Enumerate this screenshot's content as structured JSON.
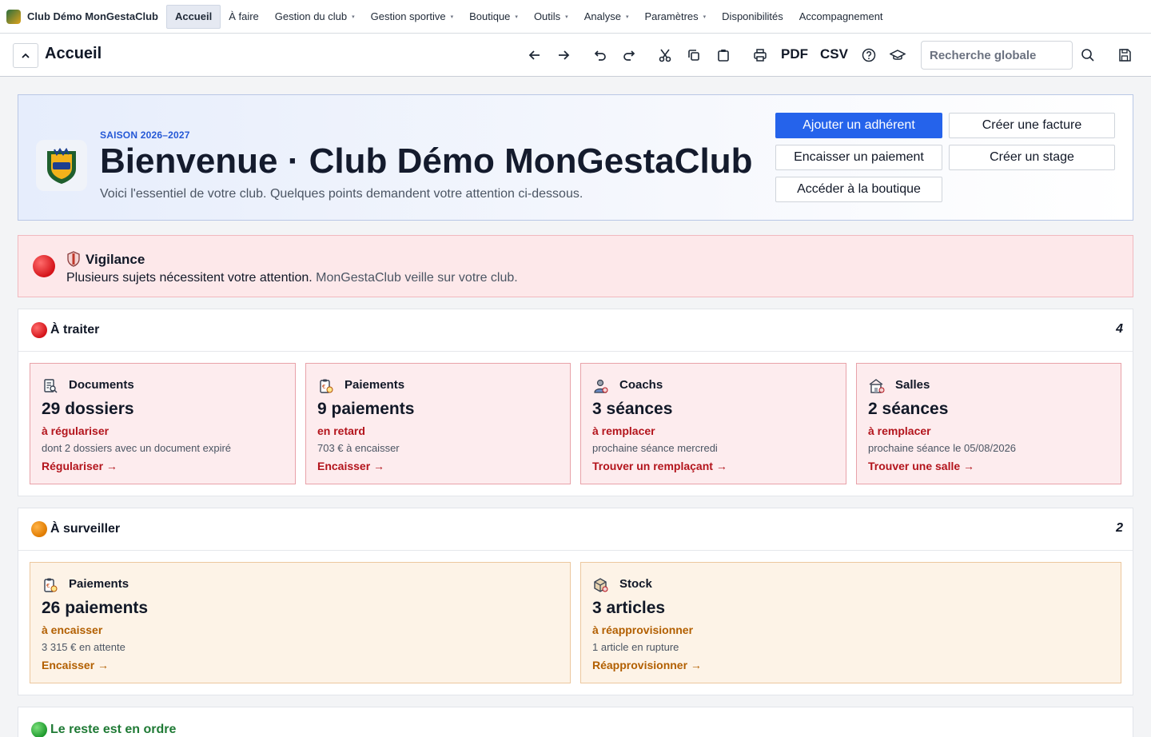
{
  "menubar": {
    "brand": "Club Démo MonGestaClub",
    "items": [
      {
        "label": "Accueil",
        "active": true,
        "dropdown": false
      },
      {
        "label": "À faire",
        "active": false,
        "dropdown": false
      },
      {
        "label": "Gestion du club",
        "active": false,
        "dropdown": true
      },
      {
        "label": "Gestion sportive",
        "active": false,
        "dropdown": true
      },
      {
        "label": "Boutique",
        "active": false,
        "dropdown": true
      },
      {
        "label": "Outils",
        "active": false,
        "dropdown": true
      },
      {
        "label": "Analyse",
        "active": false,
        "dropdown": true
      },
      {
        "label": "Paramètres",
        "active": false,
        "dropdown": true
      },
      {
        "label": "Disponibilités",
        "active": false,
        "dropdown": false
      },
      {
        "label": "Accompagnement",
        "active": false,
        "dropdown": false
      }
    ],
    "caret": "▾"
  },
  "toolbar": {
    "title": "Accueil",
    "pdf": "PDF",
    "csv": "CSV",
    "search_placeholder": "Recherche globale",
    "icons": [
      "back-arrow-icon",
      "forward-arrow-icon",
      "undo-icon",
      "redo-icon",
      "scissors-icon",
      "copy-icon",
      "paste-icon",
      "print-icon",
      "help-icon",
      "graduation-cap-icon",
      "search-icon",
      "save-icon"
    ]
  },
  "hero": {
    "season": "SAISON 2026–2027",
    "title": "Bienvenue · Club Démo MonGestaClub",
    "subtitle": "Voici l'essentiel de votre club. Quelques points demandent votre attention ci-dessous.",
    "actions": {
      "add_member": "Ajouter un adhérent",
      "create_invoice": "Créer une facture",
      "collect_payment": "Encaisser un paiement",
      "create_course": "Créer un stage",
      "shop": "Accéder à la boutique"
    }
  },
  "vigilance": {
    "title": "Vigilance",
    "text": "Plusieurs sujets nécessitent votre attention.",
    "muted": "MonGestaClub veille sur votre club."
  },
  "sections": {
    "todo": {
      "title": "À traiter",
      "count": "4",
      "cards": [
        {
          "category": "Documents",
          "number": "29 dossiers",
          "status": "à régulariser",
          "detail": "dont 2 dossiers avec un document expiré",
          "link": "Régulariser →"
        },
        {
          "category": "Paiements",
          "number": "9 paiements",
          "status": "en retard",
          "detail": "703 € à encaisser",
          "link": "Encaisser →"
        },
        {
          "category": "Coachs",
          "number": "3 séances",
          "status": "à remplacer",
          "detail": "prochaine séance mercredi",
          "link": "Trouver un remplaçant →"
        },
        {
          "category": "Salles",
          "number": "2 séances",
          "status": "à remplacer",
          "detail": "prochaine séance le 05/08/2026",
          "link": "Trouver une salle →"
        }
      ]
    },
    "watch": {
      "title": "À surveiller",
      "count": "2",
      "cards": [
        {
          "category": "Paiements",
          "number": "26 paiements",
          "status": "à encaisser",
          "detail": "3 315 € en attente",
          "link": "Encaisser →"
        },
        {
          "category": "Stock",
          "number": "3 articles",
          "status": "à réapprovisionner",
          "detail": "1 article en rupture",
          "link": "Réapprovisionner →"
        }
      ]
    },
    "ok": {
      "title": "Le reste est en ordre"
    }
  },
  "colors": {
    "accent": "#2563eb",
    "danger": "#b3141c",
    "warning": "#b25f00",
    "success": "#1f7a35"
  }
}
